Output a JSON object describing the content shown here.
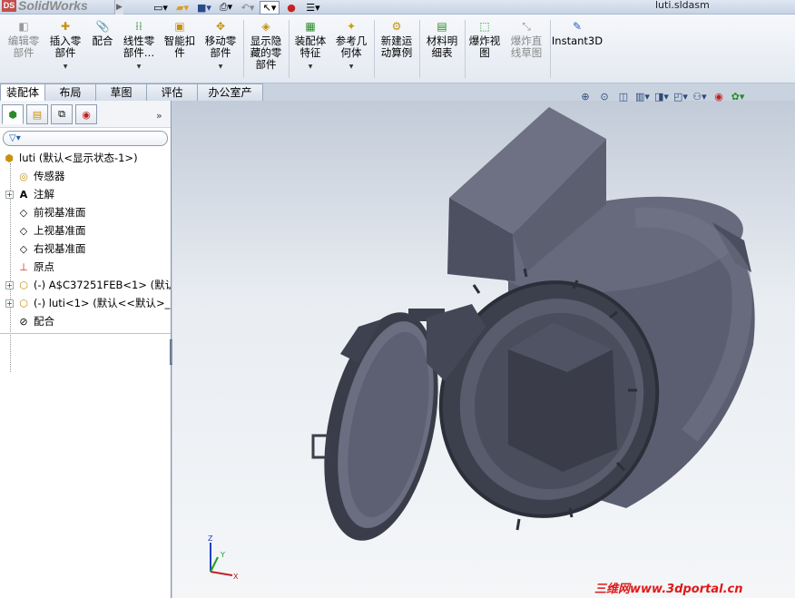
{
  "app": {
    "name": "SolidWorks",
    "document_title": "luti.sldasm"
  },
  "quick_access": [
    "new-icon",
    "open-icon",
    "save-icon",
    "print-icon",
    "undo-icon",
    "select-icon",
    "rebuild-icon",
    "options-icon"
  ],
  "command_manager": [
    {
      "label": "编辑零\n部件",
      "icon": "edit-part-icon",
      "dim": true
    },
    {
      "label": "插入零\n部件",
      "icon": "insert-components-icon",
      "dropdown": true
    },
    {
      "label": "配合",
      "icon": "mate-icon"
    },
    {
      "label": "线性零\n部件…",
      "icon": "linear-pattern-icon",
      "dropdown": true
    },
    {
      "label": "智能扣\n件",
      "icon": "smart-fasteners-icon"
    },
    {
      "label": "移动零\n部件",
      "icon": "move-component-icon",
      "dropdown": true
    },
    {
      "label": "显示隐\n藏的零\n部件",
      "icon": "show-hidden-icon"
    },
    {
      "label": "装配体\n特征",
      "icon": "assembly-features-icon",
      "dropdown": true
    },
    {
      "label": "参考几\n何体",
      "icon": "reference-geometry-icon",
      "dropdown": true
    },
    {
      "label": "新建运\n动算例",
      "icon": "new-motion-study-icon"
    },
    {
      "label": "材料明\n细表",
      "icon": "bill-of-materials-icon"
    },
    {
      "label": "爆炸视\n图",
      "icon": "exploded-view-icon"
    },
    {
      "label": "爆炸直\n线草图",
      "icon": "explode-line-sketch-icon",
      "dim": true
    },
    {
      "label": "Instant3D",
      "icon": "instant3d-icon"
    }
  ],
  "tabs": [
    "装配体",
    "布局",
    "草图",
    "评估",
    "办公室产品"
  ],
  "active_tab": "装配体",
  "tree": {
    "root": "luti  (默认<显示状态-1>)",
    "items": [
      {
        "label": "传感器",
        "icon": "sensors-icon",
        "expandable": false
      },
      {
        "label": "注解",
        "icon": "annotations-icon",
        "expandable": true
      },
      {
        "label": "前视基准面",
        "icon": "plane-icon",
        "expandable": false
      },
      {
        "label": "上视基准面",
        "icon": "plane-icon",
        "expandable": false
      },
      {
        "label": "右视基准面",
        "icon": "plane-icon",
        "expandable": false
      },
      {
        "label": "原点",
        "icon": "origin-icon",
        "expandable": false
      },
      {
        "label": "(-) A$C37251FEB<1> (默认",
        "icon": "part-icon",
        "expandable": true
      },
      {
        "label": "(-) luti<1> (默认<<默认>_",
        "icon": "part-icon",
        "expandable": true
      },
      {
        "label": "配合",
        "icon": "mates-folder-icon",
        "expandable": false
      }
    ]
  },
  "watermark": "三维网www.3dportal.cn",
  "colors": {
    "model": "#5d6173",
    "model_dark": "#3e4150",
    "model_light": "#8a8d9c"
  }
}
